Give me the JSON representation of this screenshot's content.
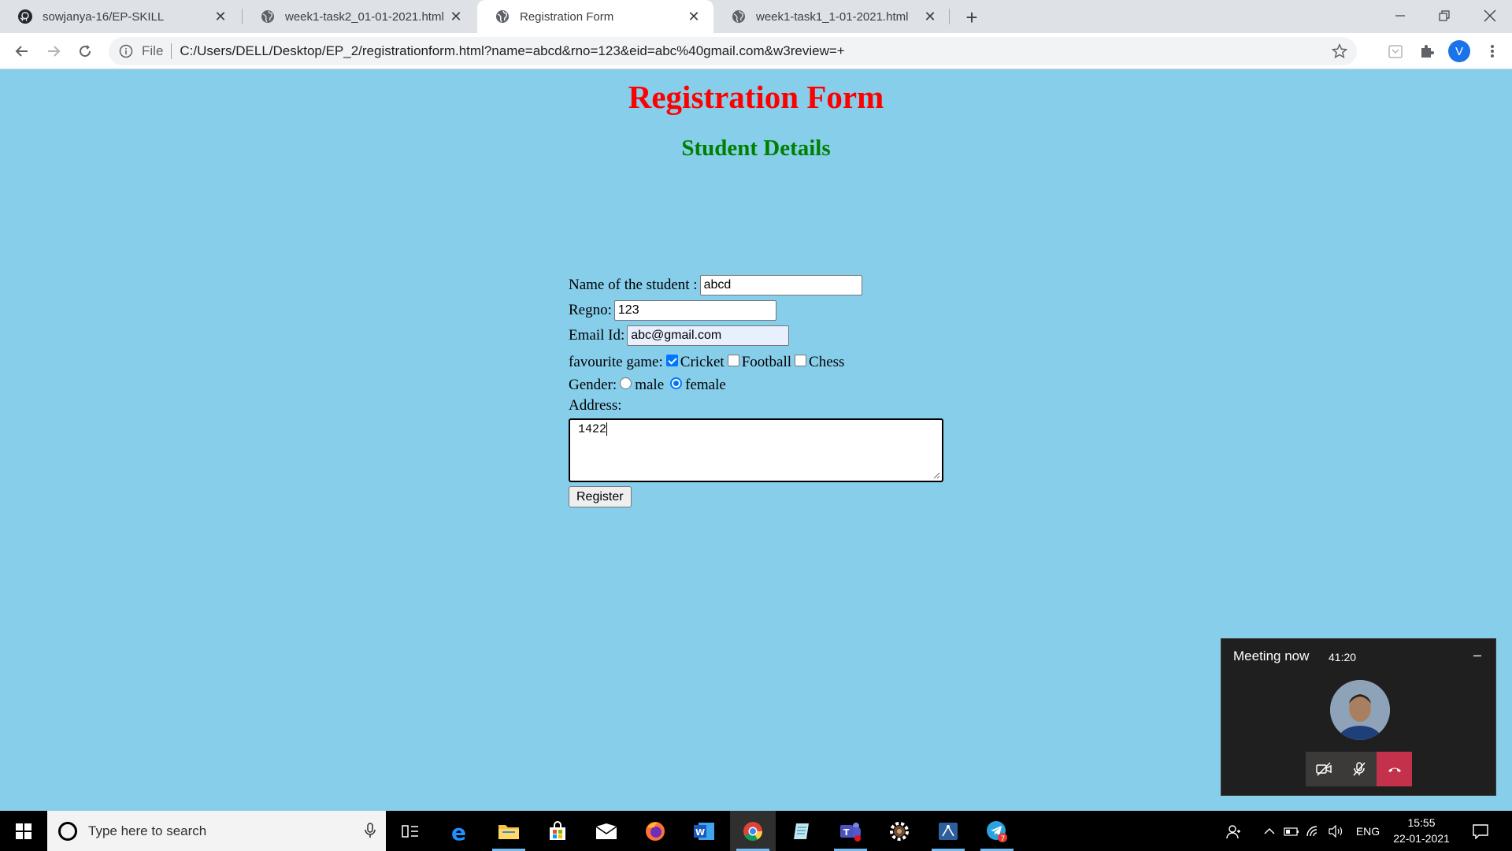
{
  "browser": {
    "tabs": [
      {
        "title": "sowjanya-16/EP-SKILL",
        "icon": "github-icon"
      },
      {
        "title": "week1-task2_01-01-2021.html",
        "icon": "globe-icon"
      },
      {
        "title": "Registration Form",
        "icon": "globe-icon",
        "active": true
      },
      {
        "title": "week1-task1_1-01-2021.html",
        "icon": "globe-icon"
      }
    ],
    "close_glyph": "✕",
    "new_tab_glyph": "+",
    "address": {
      "scheme": "File",
      "url": "C:/Users/DELL/Desktop/EP_2/registrationform.html?name=abcd&rno=123&eid=abc%40gmail.com&w3review=+"
    },
    "profile_initial": "V"
  },
  "page": {
    "title": "Registration Form",
    "subtitle": "Student Details",
    "title_color": "#ff0000",
    "subtitle_color": "#008000",
    "background": "#87ceeb",
    "form": {
      "name_label": "Name of the student :",
      "name_value": "abcd",
      "regno_label": "Regno:",
      "regno_value": "123",
      "email_label": "Email Id:",
      "email_value": "abc@gmail.com",
      "game_label": "favourite game:",
      "games": [
        {
          "label": "Cricket",
          "checked": true
        },
        {
          "label": "Football",
          "checked": false
        },
        {
          "label": "Chess",
          "checked": false
        }
      ],
      "gender_label": "Gender:",
      "genders": [
        {
          "label": "male",
          "checked": false
        },
        {
          "label": "female",
          "checked": true
        }
      ],
      "address_label": "Address:",
      "address_value": "1422",
      "submit_label": "Register"
    }
  },
  "meeting": {
    "title": "Meeting now",
    "elapsed": "41:20",
    "minimize_glyph": "–"
  },
  "taskbar": {
    "search_placeholder": "Type here to search",
    "apps": [
      "task-view-icon",
      "edge-icon",
      "file-explorer-icon",
      "store-icon",
      "mail-icon",
      "firefox-icon",
      "word-icon",
      "chrome-icon",
      "notepad-icon",
      "teams-icon",
      "settings-icon",
      "snipping-icon",
      "telegram-icon"
    ],
    "telegram_badge": "7",
    "language": "ENG",
    "time": "15:55",
    "date": "22-01-2021"
  }
}
